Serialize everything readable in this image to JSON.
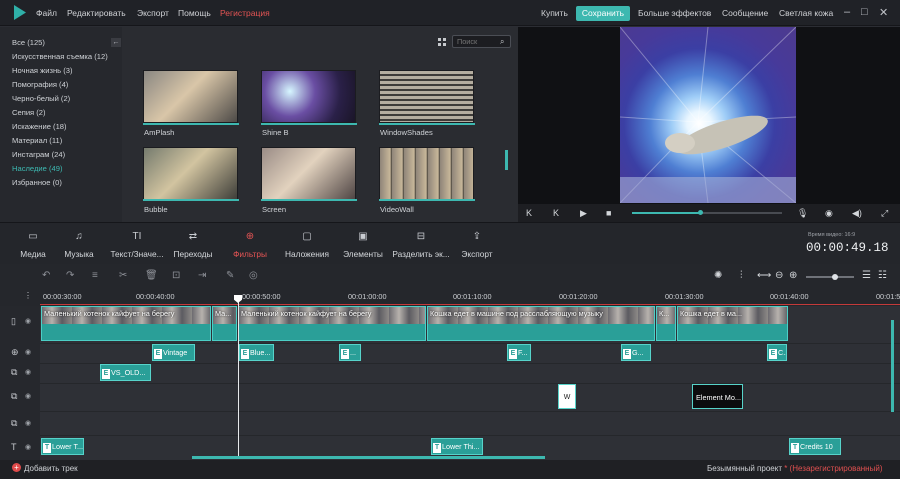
{
  "menu": {
    "items": [
      "Файл",
      "Редактировать",
      "Экспорт",
      "Помощь"
    ],
    "register": "Регистрация"
  },
  "topright": {
    "buy": "Купить",
    "save": "Сохранить",
    "more_effects": "Больше эффектов",
    "message": "Сообщение",
    "theme": "Светлая кожа"
  },
  "library": {
    "categories": [
      "Все (125)",
      "Искусственная съемка (12)",
      "Ночная жизнь (3)",
      "Помография (4)",
      "Черно-белый (2)",
      "Сепия (2)",
      "Искажение (18)",
      "Материал (11)",
      "Инстаграм (24)",
      "Наследие (49)",
      "Избранное (0)"
    ],
    "search_placeholder": "Поиск",
    "filters": [
      "AmPlash",
      "Shine B",
      "WindowShades",
      "Bubble",
      "Screen",
      "VideoWall"
    ]
  },
  "tabs": [
    "Медиа",
    "Музыка",
    "Текст/Значе...",
    "Переходы",
    "Фильтры",
    "Наложения",
    "Элементы",
    "Разделить эк...",
    "Экспорт"
  ],
  "time": {
    "label": "Время видео: 16:9",
    "timecode": "00:00:49.18"
  },
  "ruler": [
    "00:00:30:00",
    "00:00:40:00",
    "00:00:50:00",
    "00:01:00:00",
    "00:01:10:00",
    "00:01:20:00",
    "00:01:30:00",
    "00:01:40:00",
    "00:01:5"
  ],
  "video_clips": [
    "Маленький котенок кайфует на берегу",
    "Ма...",
    "Маленький котенок кайфует на берегу",
    "Кошка едет в машине под расслабляющую музыку",
    "К...",
    "Кошка едет в ма..."
  ],
  "effect_clips": [
    "Vintage",
    "Blue...",
    "...",
    "F...",
    "G...",
    "C..."
  ],
  "overlay_clips": [
    "VS_OLD..."
  ],
  "element_clips": [
    "W",
    "Element Mo..."
  ],
  "text_clips": [
    "Lower T...",
    "Lower Thi...",
    "Credits 10"
  ],
  "bottom": {
    "add_track": "Добавить трек",
    "project": "Безымянный проект",
    "unregistered": "* (Незарегистрированный)"
  },
  "colors": {
    "accent": "#3db8b0",
    "red": "#e45454"
  }
}
